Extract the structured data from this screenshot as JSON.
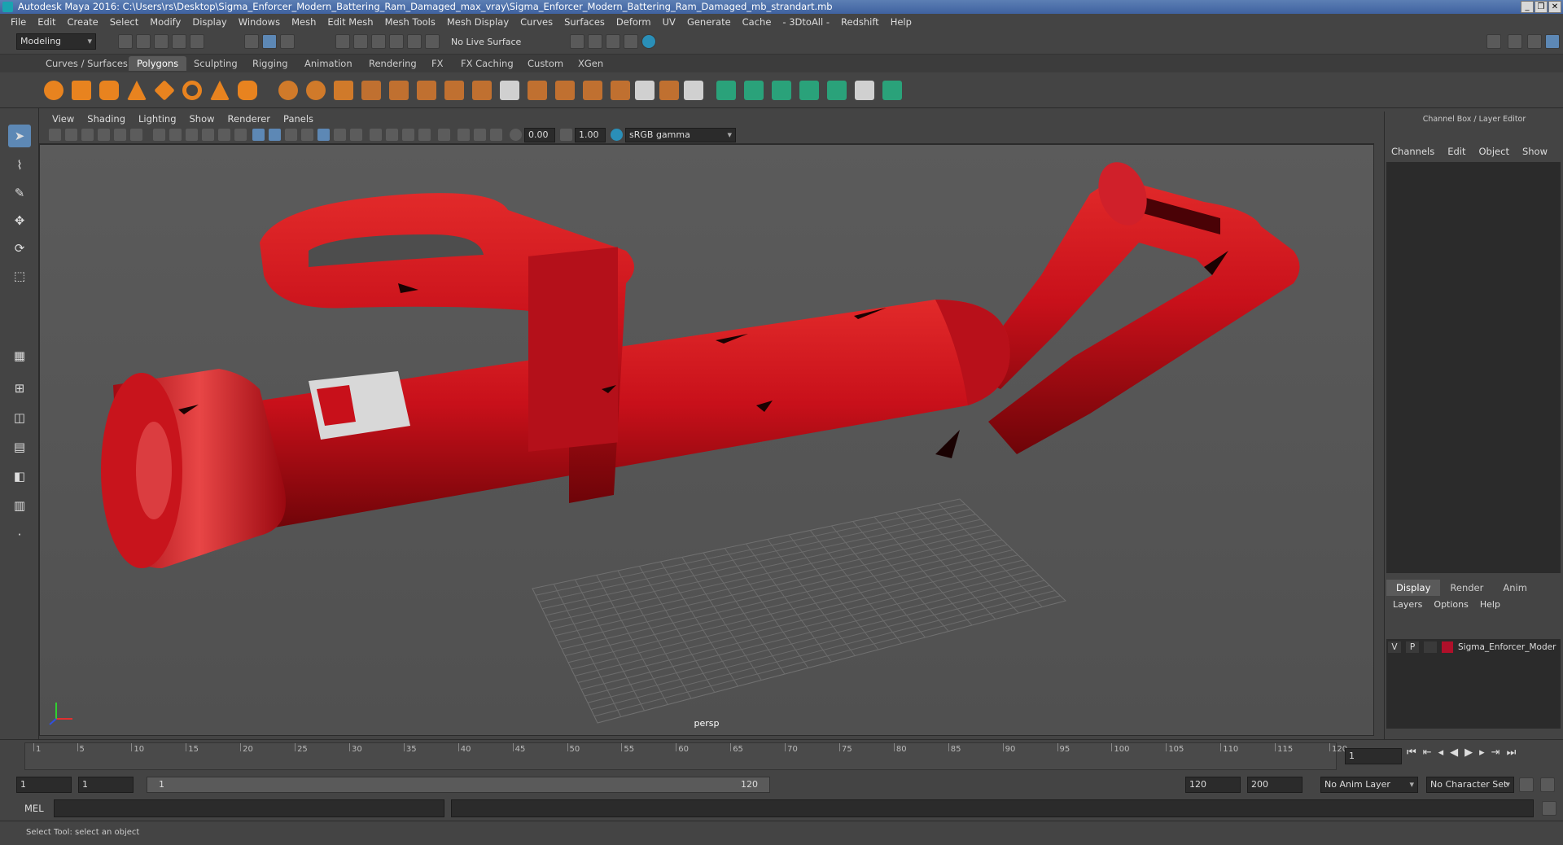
{
  "title": "Autodesk Maya 2016: C:\\Users\\rs\\Desktop\\Sigma_Enforcer_Modern_Battering_Ram_Damaged_max_vray\\Sigma_Enforcer_Modern_Battering_Ram_Damaged_mb_strandart.mb",
  "window_buttons": [
    "_",
    "❐",
    "✕"
  ],
  "menus": [
    "File",
    "Edit",
    "Create",
    "Select",
    "Modify",
    "Display",
    "Windows",
    "Mesh",
    "Edit Mesh",
    "Mesh Tools",
    "Mesh Display",
    "Curves",
    "Surfaces",
    "Deform",
    "UV",
    "Generate",
    "Cache",
    "- 3DtoAll -",
    "Redshift",
    "Help"
  ],
  "status": {
    "mode": "Modeling",
    "live_surface": "No Live Surface"
  },
  "shelf_tabs": [
    "Curves / Surfaces",
    "Polygons",
    "Sculpting",
    "Rigging",
    "Animation",
    "Rendering",
    "FX",
    "FX Caching",
    "Custom",
    "XGen"
  ],
  "active_shelf_tab": "Polygons",
  "viewport": {
    "menus": [
      "View",
      "Shading",
      "Lighting",
      "Show",
      "Renderer",
      "Panels"
    ],
    "exposure": "0.00",
    "gamma": "1.00",
    "color_space": "sRGB gamma",
    "camera_label": "persp"
  },
  "channel_box": {
    "title": "Channel Box / Layer Editor",
    "menus": [
      "Channels",
      "Edit",
      "Object",
      "Show"
    ],
    "tabs": [
      "Display",
      "Render",
      "Anim"
    ],
    "active_tab": "Display",
    "layer_menus": [
      "Layers",
      "Options",
      "Help"
    ],
    "layer": {
      "v": "V",
      "p": "P",
      "name": "Sigma_Enforcer_Moder",
      "color": "#b0102a"
    }
  },
  "timeline": {
    "ticks": [
      "1",
      "5",
      "10",
      "15",
      "20",
      "25",
      "30",
      "35",
      "40",
      "45",
      "50",
      "55",
      "60",
      "65",
      "70",
      "75",
      "80",
      "85",
      "90",
      "95",
      "100",
      "105",
      "110",
      "115",
      "120"
    ],
    "current_frame": "1"
  },
  "range": {
    "start": "1",
    "playback_start": "1",
    "slider_start": "1",
    "slider_end": "120",
    "playback_end": "120",
    "end": "200",
    "anim_layer": "No Anim Layer",
    "character_set": "No Character Set"
  },
  "cmd": {
    "lang": "MEL"
  },
  "help_text": "Select Tool: select an object",
  "colors": {
    "object_red": "#c8101a",
    "active_tool": "#5d88b5"
  }
}
